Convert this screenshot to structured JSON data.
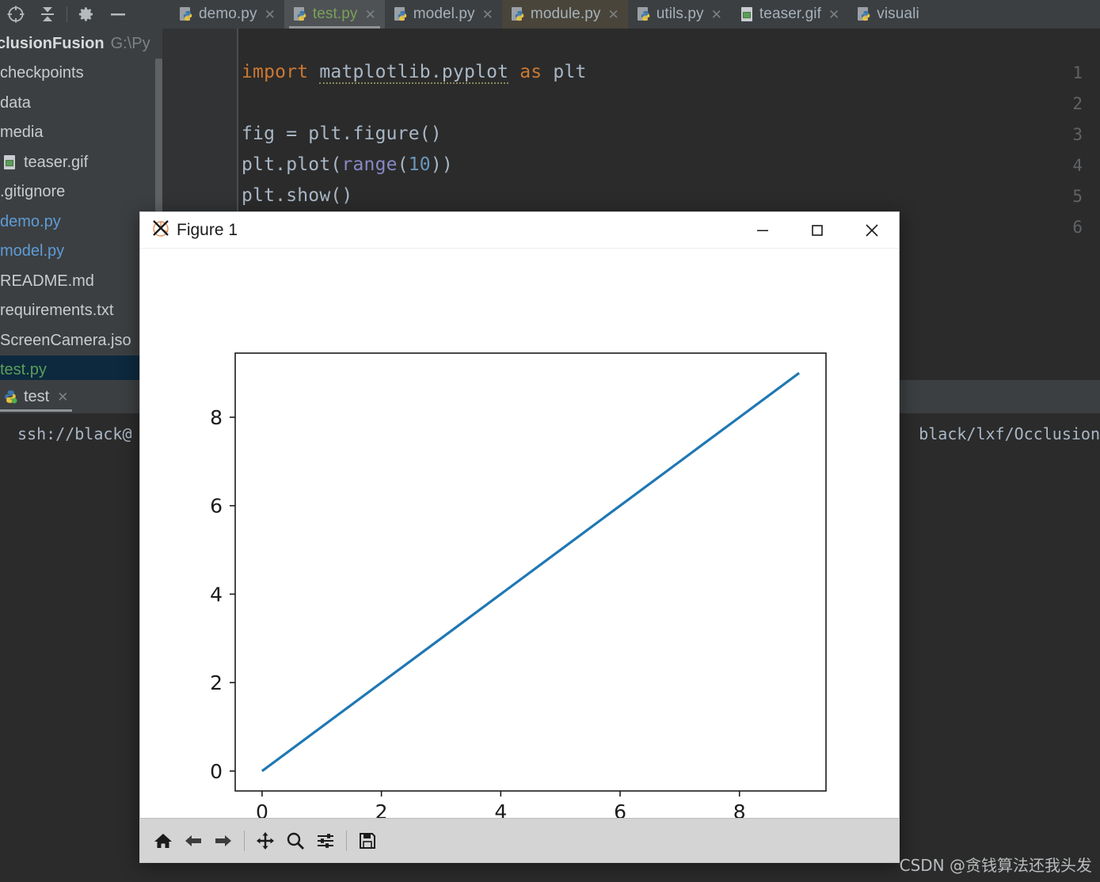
{
  "ide": {
    "toolbar_icons": [
      {
        "name": "locate-target-icon",
        "glyph": "target"
      },
      {
        "name": "collapse-all-icon",
        "glyph": "collapse"
      },
      {
        "name": "settings-gear-icon",
        "glyph": "gear"
      },
      {
        "name": "minimize-icon",
        "glyph": "minus"
      }
    ],
    "tabs": [
      {
        "label": "demo.py",
        "icon": "python-file-icon",
        "state": "inactive"
      },
      {
        "label": "test.py",
        "icon": "python-file-icon",
        "state": "active"
      },
      {
        "label": "model.py",
        "icon": "python-file-icon",
        "state": "inactive"
      },
      {
        "label": "module.py",
        "icon": "python-file-icon",
        "state": "hover"
      },
      {
        "label": "utils.py",
        "icon": "python-file-icon",
        "state": "inactive"
      },
      {
        "label": "teaser.gif",
        "icon": "image-file-icon",
        "state": "inactive"
      },
      {
        "label": "visuali",
        "icon": "python-file-icon",
        "state": "inactive"
      }
    ],
    "project": {
      "header_name": "clusionFusion",
      "header_path": "G:\\Py",
      "tree": [
        {
          "label": "checkpoints",
          "color": "default",
          "icon": null,
          "selected": false
        },
        {
          "label": "data",
          "color": "default",
          "icon": null,
          "selected": false
        },
        {
          "label": "media",
          "color": "default",
          "icon": null,
          "selected": false
        },
        {
          "label": "teaser.gif",
          "color": "default",
          "icon": "image-file-icon",
          "selected": false
        },
        {
          "label": ".gitignore",
          "color": "default",
          "icon": null,
          "selected": false
        },
        {
          "label": "demo.py",
          "color": "blue",
          "icon": null,
          "selected": false
        },
        {
          "label": "model.py",
          "color": "blue",
          "icon": null,
          "selected": false
        },
        {
          "label": "README.md",
          "color": "default",
          "icon": null,
          "selected": false
        },
        {
          "label": "requirements.txt",
          "color": "default",
          "icon": null,
          "selected": false
        },
        {
          "label": "ScreenCamera.jso",
          "color": "default",
          "icon": null,
          "selected": false
        },
        {
          "label": "test.py",
          "color": "green",
          "icon": null,
          "selected": true
        }
      ]
    },
    "run_window": {
      "tab_label": "test",
      "console_left": "ssh://black@",
      "console_right": "black/lxf/Occlusion"
    },
    "editor": {
      "lines": [
        "1",
        "2",
        "3",
        "4",
        "5",
        "6"
      ],
      "code": [
        "import matplotlib.pyplot as plt",
        "",
        "fig = plt.figure()",
        "plt.plot(range(10))",
        "plt.show()",
        ""
      ]
    }
  },
  "figure_window": {
    "title": "Figure 1",
    "icon": "matplotlib-logo-icon",
    "window_controls": [
      {
        "name": "minimize-button",
        "label": "—"
      },
      {
        "name": "maximize-button",
        "label": "□"
      },
      {
        "name": "close-button",
        "label": "✕"
      }
    ],
    "toolbar": [
      {
        "name": "home-button",
        "tooltip": "Home"
      },
      {
        "name": "back-button",
        "tooltip": "Back"
      },
      {
        "name": "forward-button",
        "tooltip": "Forward"
      },
      {
        "name": "pan-button",
        "tooltip": "Pan"
      },
      {
        "name": "zoom-button",
        "tooltip": "Zoom to rectangle"
      },
      {
        "name": "configure-subplots-button",
        "tooltip": "Configure subplots"
      },
      {
        "name": "save-button",
        "tooltip": "Save the figure"
      }
    ]
  },
  "chart_data": {
    "type": "line",
    "title": "",
    "xlabel": "",
    "ylabel": "",
    "x": [
      0,
      1,
      2,
      3,
      4,
      5,
      6,
      7,
      8,
      9
    ],
    "series": [
      {
        "name": "range(10)",
        "values": [
          0,
          1,
          2,
          3,
          4,
          5,
          6,
          7,
          8,
          9
        ],
        "color": "#1f77b4"
      }
    ],
    "xlim": [
      -0.45,
      9.45
    ],
    "ylim": [
      -0.45,
      9.45
    ],
    "xticks": [
      "0",
      "2",
      "4",
      "6",
      "8"
    ],
    "xtick_values": [
      0,
      2,
      4,
      6,
      8
    ],
    "yticks": [
      "0",
      "2",
      "4",
      "6",
      "8"
    ],
    "ytick_values": [
      0,
      2,
      4,
      6,
      8
    ],
    "grid": false,
    "legend": null
  },
  "watermark": {
    "text": "CSDN @贪钱算法还我头发"
  },
  "colors": {
    "line": "#1f77b4",
    "ide_bg": "#3c3f41",
    "editor_bg": "#2b2b2b",
    "active_tab": "#4e5254",
    "selection": "#0d293e"
  }
}
